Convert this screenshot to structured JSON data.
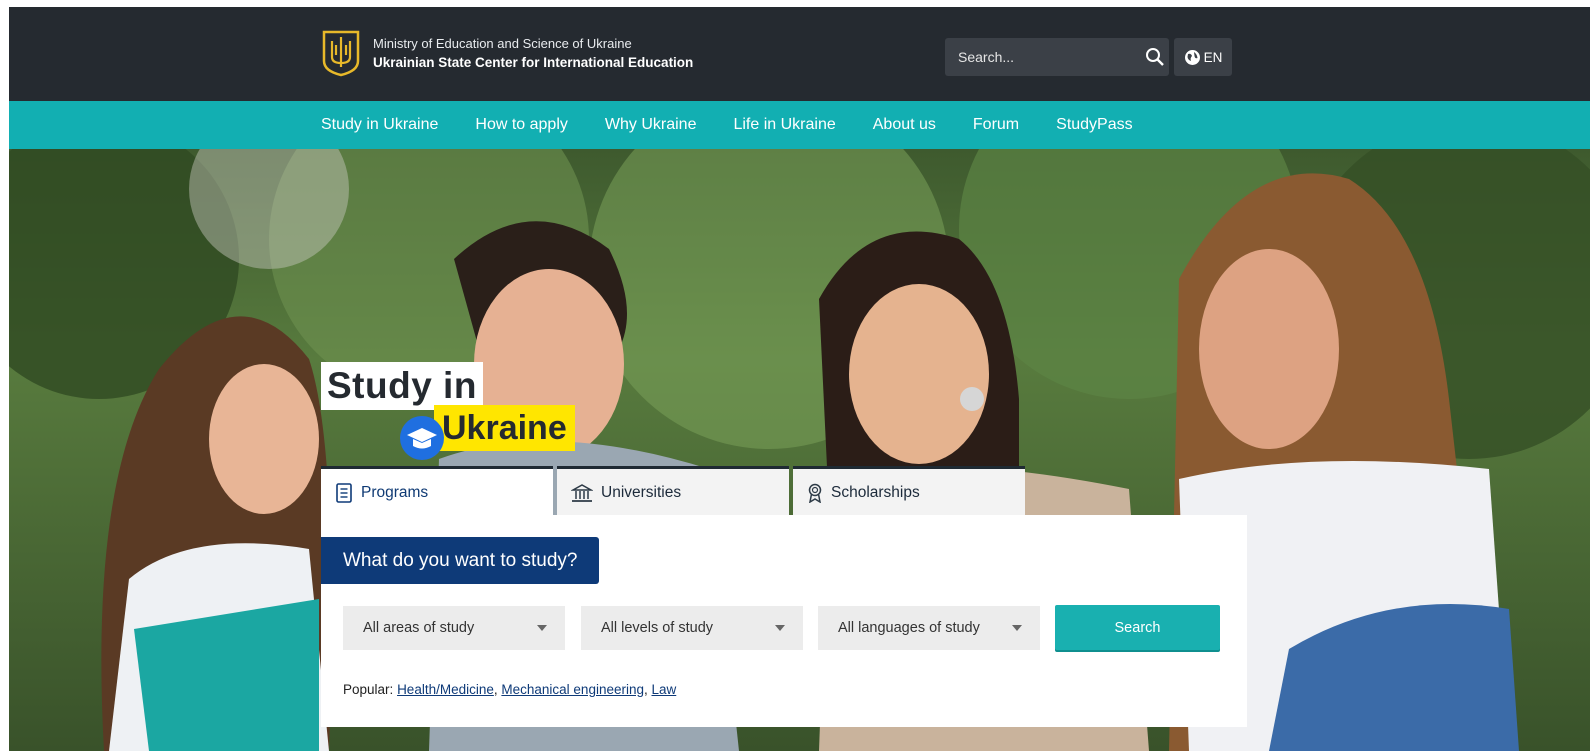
{
  "header": {
    "ministry": "Ministry of Education and Science of Ukraine",
    "center": "Ukrainian State Center for International Education",
    "search_placeholder": "Search...",
    "language": "EN"
  },
  "nav": {
    "items": [
      {
        "label": "Study in Ukraine"
      },
      {
        "label": "How to apply"
      },
      {
        "label": "Why Ukraine"
      },
      {
        "label": "Life in Ukraine"
      },
      {
        "label": "About us"
      },
      {
        "label": "Forum"
      },
      {
        "label": "StudyPass"
      }
    ]
  },
  "hero": {
    "brand_line1": "Study in",
    "brand_line2": "Ukraine"
  },
  "search_panel": {
    "tabs": [
      {
        "label": "Programs",
        "icon": "document-list-icon",
        "active": true
      },
      {
        "label": "Universities",
        "icon": "building-icon",
        "active": false
      },
      {
        "label": "Scholarships",
        "icon": "award-icon",
        "active": false
      }
    ],
    "question": "What do you want to study?",
    "selects": [
      {
        "value": "All areas of study"
      },
      {
        "value": "All levels of study"
      },
      {
        "value": "All languages of study"
      }
    ],
    "search_button": "Search",
    "popular_label": "Popular:",
    "popular_links": [
      "Health/Medicine",
      "Mechanical engineering",
      "Law"
    ]
  },
  "colors": {
    "topbar": "#252a30",
    "nav": "#12afb2",
    "brand_yellow": "#ffe600",
    "primary_navy": "#0e3a78",
    "accent_teal": "#19b0b0"
  }
}
